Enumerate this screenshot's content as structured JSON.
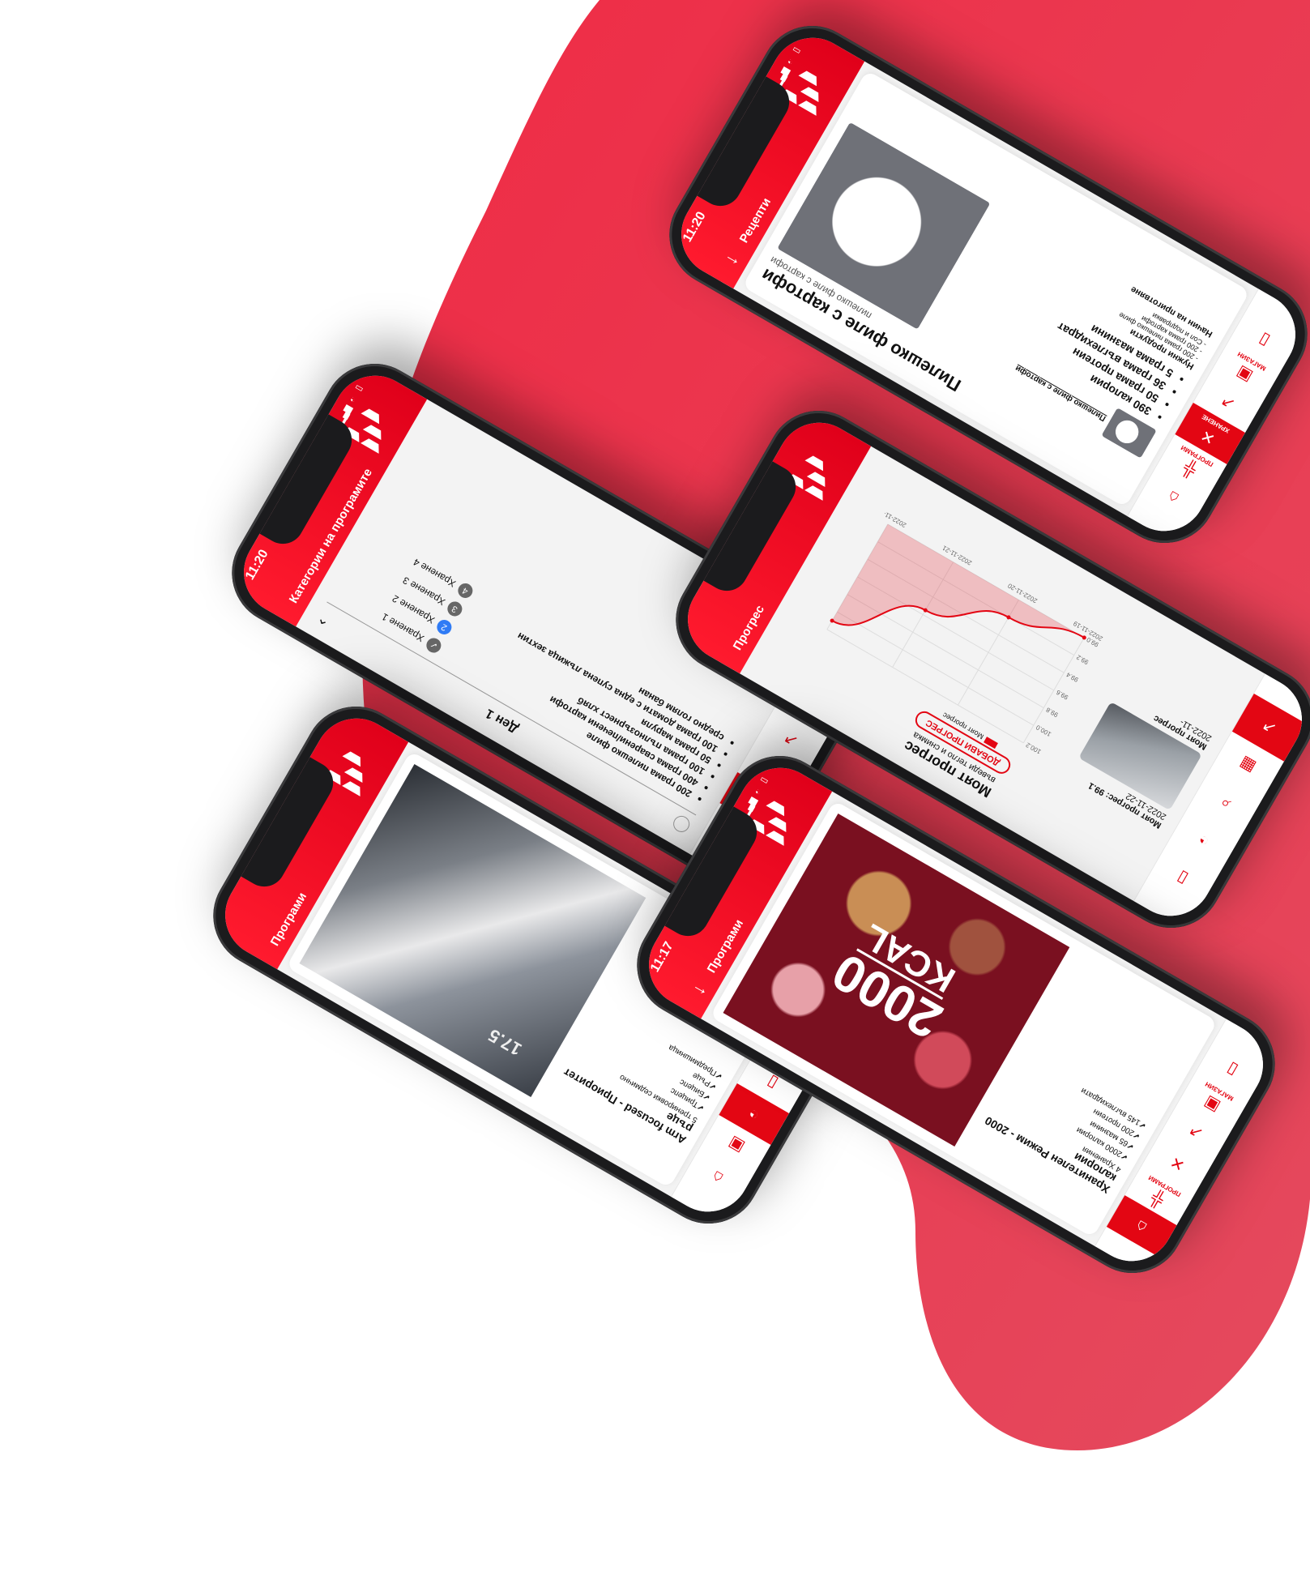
{
  "colors": {
    "brand": "#e30613",
    "brand_dark": "#c8001a",
    "blob": "#ee2f48",
    "paper": "#ffffff"
  },
  "tabbar_labels": {
    "home": "",
    "programs": "ПРОГРАМИ",
    "nutrition": "ХРАНЕНЕ",
    "progress": "",
    "shop": "МАГАЗИН",
    "library": ""
  },
  "recipe": {
    "header": "Рецепти",
    "time": "11:20",
    "title": "Пилешко филе с картофи",
    "subtitle": "пилешко филе с картофи",
    "thumb_caption": "Пилешко филе с картофи",
    "macros": [
      "390 калории",
      "50 грама протеин",
      "36 грама въглехидрат",
      "5 грама мазнини"
    ],
    "ingredients_title": "Нужни продукти",
    "ingredients": [
      "- 200 грама пилешко филе",
      "- 200 грама картофи",
      "- Сол и подправки"
    ],
    "method_title": "Начин на приготвяне"
  },
  "meal_plan": {
    "header": "Категории на програмите",
    "time": "11:20",
    "day": "Ден 1",
    "steps": [
      {
        "num": "1",
        "label": "Хранене 1",
        "state": "done"
      },
      {
        "num": "2",
        "label": "Хранене 2",
        "state": "active"
      },
      {
        "num": "3",
        "label": "Хранене 3",
        "state": "todo"
      },
      {
        "num": "4",
        "label": "Хранене 4",
        "state": "todo"
      }
    ],
    "items": [
      "200 грама пилешко филе",
      "400 грама сварени/печени картофи",
      "100 грама пълнозърнест хляб",
      "50 грама маруля",
      "100 грама домати с една супена лъжица зехтин",
      "средно голям банан"
    ]
  },
  "progress": {
    "header": "Прогрес",
    "title": "Моят прогрес",
    "subtitle": "въведи тегло и снимка",
    "add_button": "ДОБАВИ ПРОГРЕС",
    "legend": "Моят прогрес",
    "entry1_title": "Моят прогрес: 99.1",
    "entry1_date": "2022-11-22",
    "entry2_title": "Моят прогрес",
    "entry2_date": "2022-11-"
  },
  "chart_data": {
    "type": "area",
    "title": "",
    "xlabel": "",
    "ylabel": "",
    "categories": [
      "2022-11-19",
      "2022-11-20",
      "2022-11-21",
      "2022-11-22"
    ],
    "y_ticks": [
      "99.0",
      "99.2",
      "99.4",
      "99.6",
      "99.8",
      "100.0",
      "100.2"
    ],
    "ylim": [
      99.0,
      100.2
    ],
    "series": [
      {
        "name": "Моят прогрес",
        "values": [
          99.0,
          99.2,
          99.55,
          100.1
        ]
      }
    ],
    "grid": true,
    "legend_position": "top"
  },
  "program": {
    "header": "Програми",
    "title": "Arm focused - Приоритет ръце",
    "sessions": "5 тренировки седмично",
    "checks": [
      "Трицепс",
      "Бицепс",
      "Ръце",
      "Предмишница"
    ],
    "photo_text": "17.5"
  },
  "diet": {
    "header": "Програми",
    "time": "11:17",
    "title": "Хранителен Режим - 2000 калории",
    "meals": "4 Хранения",
    "checks": [
      "2000 калории",
      "65 мазнини",
      "200 протеин",
      "145 въглехидрати"
    ],
    "banner_big": "2000",
    "banner_small": "KCAL"
  }
}
